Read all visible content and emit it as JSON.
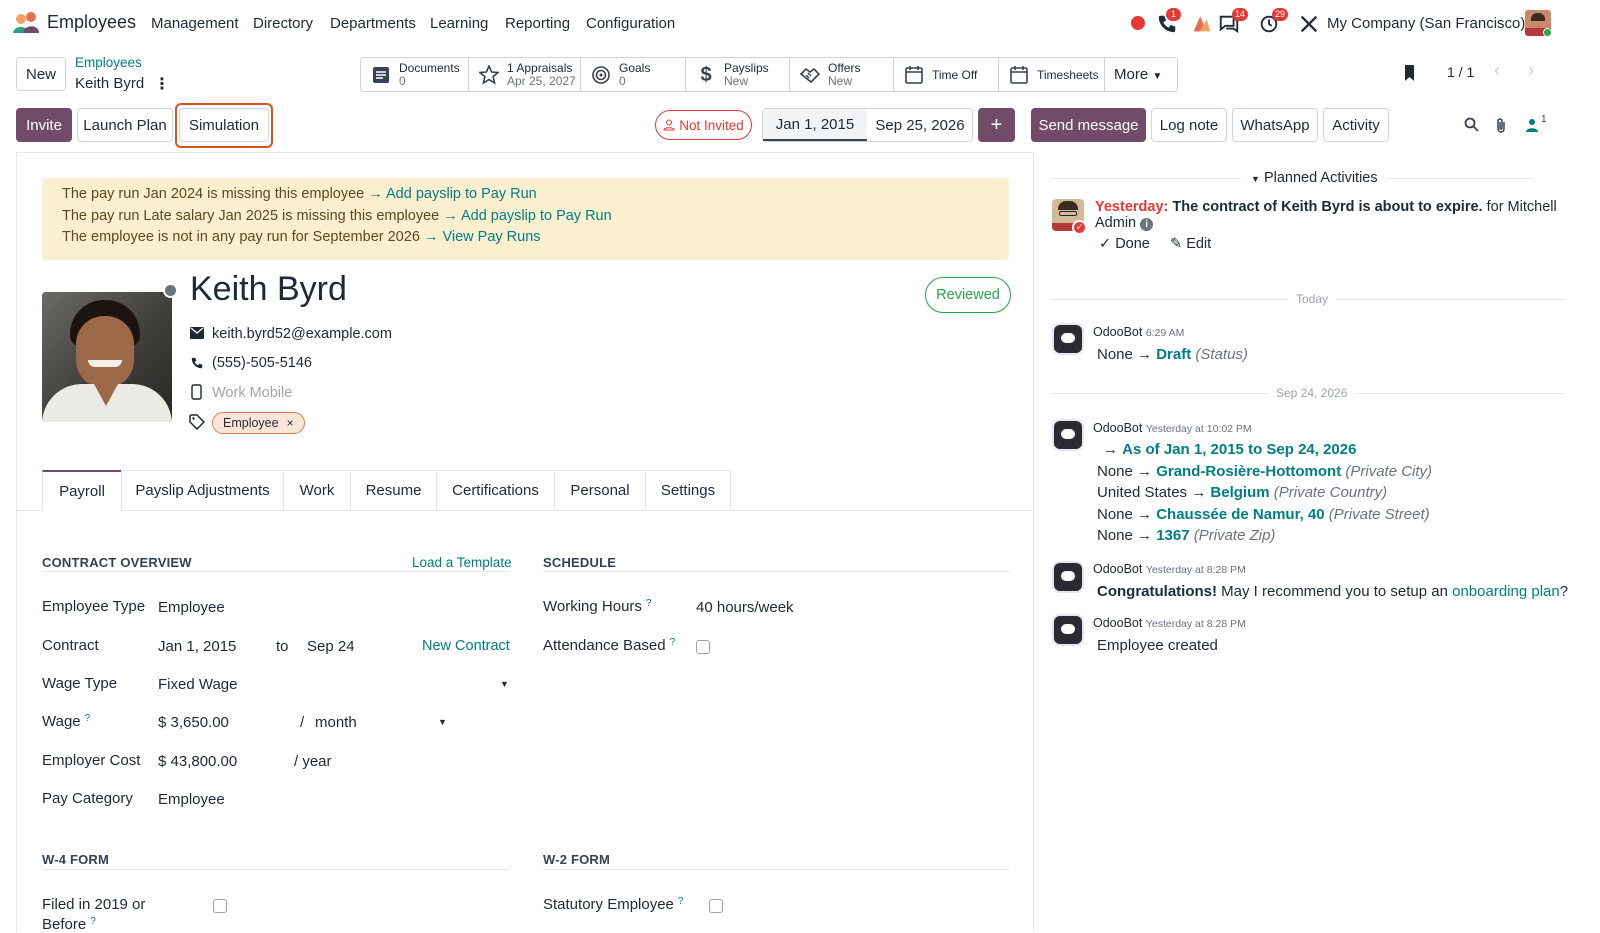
{
  "app": {
    "title": "Employees",
    "company": "My Company (San Francisco)"
  },
  "menu": [
    "Management",
    "Directory",
    "Departments",
    "Learning",
    "Reporting",
    "Configuration"
  ],
  "systray": {
    "calls_badge": "1",
    "messages_badge": "14",
    "activity_badge": "29"
  },
  "control": {
    "new_label": "New",
    "breadcrumb_parent": "Employees",
    "breadcrumb_current": "Keith Byrd",
    "pager": "1 / 1"
  },
  "smart_buttons": {
    "documents": {
      "label": "Documents",
      "sub": "0"
    },
    "appraisals": {
      "label": "1 Appraisals",
      "sub": "Apr 25, 2027"
    },
    "goals": {
      "label": "Goals",
      "sub": "0"
    },
    "payslips": {
      "label": "Payslips",
      "sub": "New"
    },
    "offers": {
      "label": "Offers",
      "sub": "New"
    },
    "timeoff": {
      "label": "Time Off"
    },
    "timesheets": {
      "label": "Timesheets"
    },
    "more": "More"
  },
  "actions": {
    "invite": "Invite",
    "launch_plan": "Launch Plan",
    "simulation": "Simulation",
    "not_invited": "Not Invited",
    "date_from": "Jan 1, 2015",
    "date_to": "Sep 25, 2026",
    "plus": "+"
  },
  "chatter_actions": {
    "send_message": "Send message",
    "log_note": "Log note",
    "whatsapp": "WhatsApp",
    "activity": "Activity",
    "followers_count": "1"
  },
  "alerts": [
    {
      "text": "The pay run Jan 2024 is missing this employee",
      "link": "→ Add payslip to Pay Run"
    },
    {
      "text": "The pay run Late salary Jan 2025 is missing this employee",
      "link": "→ Add payslip to Pay Run"
    },
    {
      "text": "The employee is not in any pay run for September 2026",
      "link": "→ View Pay Runs"
    }
  ],
  "employee": {
    "name": "Keith Byrd",
    "email": "keith.byrd52@example.com",
    "phone": "(555)-505-5146",
    "mobile_placeholder": "Work Mobile",
    "tag": "Employee",
    "status": "Reviewed"
  },
  "tabs": [
    "Payroll",
    "Payslip Adjustments",
    "Work",
    "Resume",
    "Certifications",
    "Personal",
    "Settings"
  ],
  "contract": {
    "title": "CONTRACT OVERVIEW",
    "load_template": "Load a Template",
    "employee_type_label": "Employee Type",
    "employee_type": "Employee",
    "contract_label": "Contract",
    "contract_start": "Jan 1, 2015",
    "contract_to": "to",
    "contract_end": "Sep 24",
    "new_contract": "New Contract",
    "wage_type_label": "Wage Type",
    "wage_type": "Fixed Wage",
    "wage_label": "Wage",
    "wage": "$ 3,650.00",
    "wage_sep": "/",
    "wage_period": "month",
    "employer_cost_label": "Employer Cost",
    "employer_cost": "$ 43,800.00",
    "employer_cost_period": "/ year",
    "pay_category_label": "Pay Category",
    "pay_category": "Employee"
  },
  "schedule": {
    "title": "SCHEDULE",
    "working_hours_label": "Working Hours",
    "working_hours": "40 hours/week",
    "attendance_label": "Attendance Based"
  },
  "w4": {
    "title": "W-4 FORM",
    "filed_label_1": "Filed in 2019 or",
    "filed_label_2": "Before"
  },
  "w2": {
    "title": "W-2 FORM",
    "statutory_label": "Statutory Employee"
  },
  "chatter": {
    "planned_activities": "Planned Activities",
    "activity": {
      "when": "Yesterday:",
      "text": "The contract of Keith Byrd is about to expire.",
      "for_text": "for Mitchell",
      "assignee": "Admin",
      "done": "Done",
      "edit": "Edit"
    },
    "today_label": "Today",
    "sep_label": "Sep 24, 2026",
    "messages": [
      {
        "author": "OdooBot",
        "time": "6:29 AM"
      },
      {
        "author": "OdooBot",
        "time": "Yesterday at 10:02 PM"
      },
      {
        "author": "OdooBot",
        "time": "Yesterday at 8:28 PM"
      },
      {
        "author": "OdooBot",
        "time": "Yesterday at 8:28 PM"
      }
    ],
    "m1": {
      "from": "None",
      "to": "Draft",
      "field": "(Status)"
    },
    "m2": {
      "header": "As of Jan 1, 2015 to Sep 24, 2026",
      "l1_from": "None",
      "l1_to": "Grand-Rosière-Hottomont",
      "l1_field": "(Private City)",
      "l2_from": "United States",
      "l2_to": "Belgium",
      "l2_field": "(Private Country)",
      "l3_from": "None",
      "l3_to": "Chaussée de Namur, 40",
      "l3_field": "(Private Street)",
      "l4_from": "None",
      "l4_to": "1367",
      "l4_field": "(Private Zip)"
    },
    "m3": {
      "bold": "Congratulations!",
      "text": "May I recommend you to setup an",
      "link": "onboarding plan",
      "end": "?"
    },
    "m4": {
      "text": "Employee created"
    }
  },
  "colors": {
    "brand": "#714b67",
    "link": "#017e84",
    "alert_bg": "#fcefcf",
    "danger": "#e53935"
  }
}
